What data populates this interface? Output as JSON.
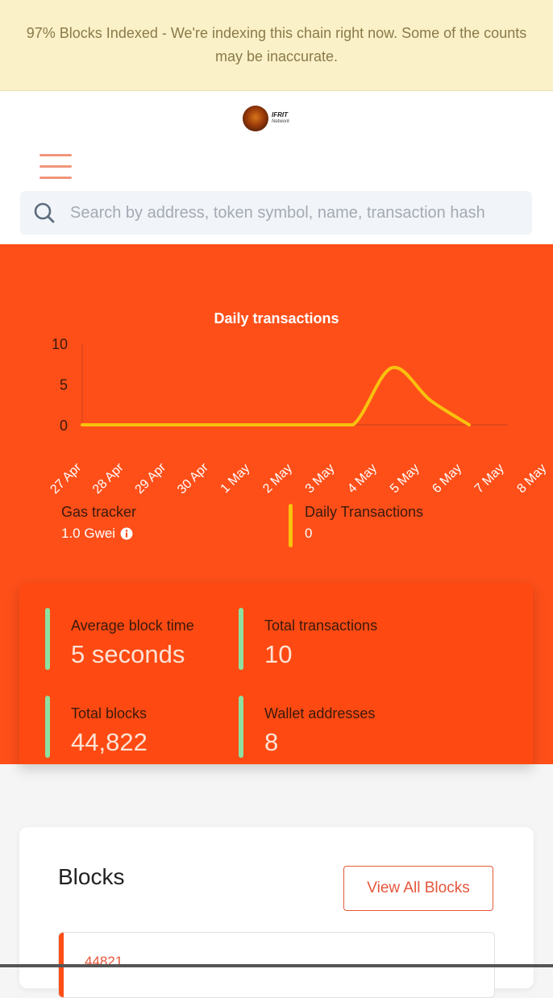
{
  "banner": {
    "text": "97% Blocks Indexed - We're indexing this chain right now. Some of the counts may be inaccurate."
  },
  "logo": {
    "title": "IFRIT",
    "subtitle": "Network"
  },
  "search": {
    "placeholder": "Search by address, token symbol, name, transaction hash"
  },
  "chart_data": {
    "type": "line",
    "title": "Daily transactions",
    "categories": [
      "27 Apr",
      "28 Apr",
      "29 Apr",
      "30 Apr",
      "1 May",
      "2 May",
      "3 May",
      "4 May",
      "5 May",
      "6 May",
      "7 May",
      "8 May"
    ],
    "y_ticks": [
      "0",
      "5",
      "10"
    ],
    "ylim": [
      0,
      10
    ],
    "series": [
      {
        "color": "#f8c20e",
        "values": [
          0,
          0,
          0,
          0,
          0,
          0,
          0,
          0,
          7,
          3,
          0,
          null
        ]
      }
    ]
  },
  "gas_tracker": {
    "label": "Gas tracker",
    "value": "1.0 Gwei"
  },
  "daily_transactions": {
    "label": "Daily Transactions",
    "value": "0"
  },
  "stats": {
    "avg_block_time": {
      "label": "Average block time",
      "value": "5 seconds"
    },
    "total_transactions": {
      "label": "Total transactions",
      "value": "10"
    },
    "total_blocks": {
      "label": "Total blocks",
      "value": "44,822"
    },
    "wallet_addresses": {
      "label": "Wallet addresses",
      "value": "8"
    }
  },
  "blocks": {
    "title": "Blocks",
    "view_all": "View All Blocks",
    "first_block": "44821"
  },
  "colors": {
    "accent": "#fe4f19",
    "line": "#f8c20e",
    "stat_bar": "#8de0a0",
    "banner_bg": "#fbf1c8"
  }
}
